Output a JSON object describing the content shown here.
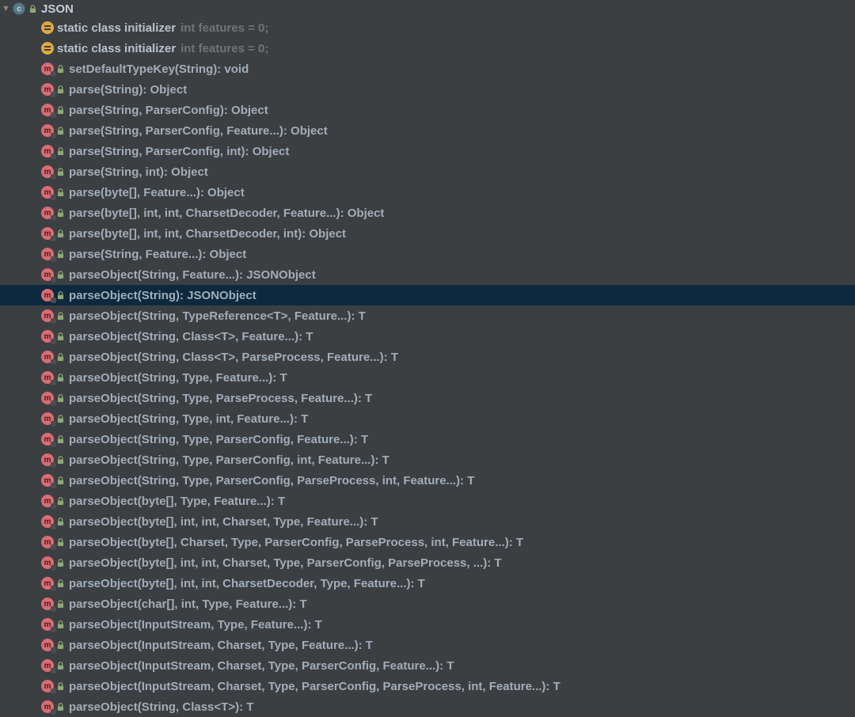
{
  "root": {
    "name": "JSON"
  },
  "items": [
    {
      "kind": "init",
      "label": "static class initializer",
      "hint": "int features = 0;",
      "selected": false
    },
    {
      "kind": "init",
      "label": "static class initializer",
      "hint": "int features = 0;",
      "selected": false
    },
    {
      "kind": "method",
      "label": "setDefaultTypeKey(String): void",
      "selected": false
    },
    {
      "kind": "method",
      "label": "parse(String): Object",
      "selected": false
    },
    {
      "kind": "method",
      "label": "parse(String, ParserConfig): Object",
      "selected": false
    },
    {
      "kind": "method",
      "label": "parse(String, ParserConfig, Feature...): Object",
      "selected": false
    },
    {
      "kind": "method",
      "label": "parse(String, ParserConfig, int): Object",
      "selected": false
    },
    {
      "kind": "method",
      "label": "parse(String, int): Object",
      "selected": false
    },
    {
      "kind": "method",
      "label": "parse(byte[], Feature...): Object",
      "selected": false
    },
    {
      "kind": "method",
      "label": "parse(byte[], int, int, CharsetDecoder, Feature...): Object",
      "selected": false
    },
    {
      "kind": "method",
      "label": "parse(byte[], int, int, CharsetDecoder, int): Object",
      "selected": false
    },
    {
      "kind": "method",
      "label": "parse(String, Feature...): Object",
      "selected": false
    },
    {
      "kind": "method",
      "label": "parseObject(String, Feature...): JSONObject",
      "selected": false
    },
    {
      "kind": "method",
      "label": "parseObject(String): JSONObject",
      "selected": true
    },
    {
      "kind": "method",
      "label": "parseObject(String, TypeReference<T>, Feature...): T",
      "selected": false
    },
    {
      "kind": "method",
      "label": "parseObject(String, Class<T>, Feature...): T",
      "selected": false
    },
    {
      "kind": "method",
      "label": "parseObject(String, Class<T>, ParseProcess, Feature...): T",
      "selected": false
    },
    {
      "kind": "method",
      "label": "parseObject(String, Type, Feature...): T",
      "selected": false
    },
    {
      "kind": "method",
      "label": "parseObject(String, Type, ParseProcess, Feature...): T",
      "selected": false
    },
    {
      "kind": "method",
      "label": "parseObject(String, Type, int, Feature...): T",
      "selected": false
    },
    {
      "kind": "method",
      "label": "parseObject(String, Type, ParserConfig, Feature...): T",
      "selected": false
    },
    {
      "kind": "method",
      "label": "parseObject(String, Type, ParserConfig, int, Feature...): T",
      "selected": false
    },
    {
      "kind": "method",
      "label": "parseObject(String, Type, ParserConfig, ParseProcess, int, Feature...): T",
      "selected": false
    },
    {
      "kind": "method",
      "label": "parseObject(byte[], Type, Feature...): T",
      "selected": false
    },
    {
      "kind": "method",
      "label": "parseObject(byte[], int, int, Charset, Type, Feature...): T",
      "selected": false
    },
    {
      "kind": "method",
      "label": "parseObject(byte[], Charset, Type, ParserConfig, ParseProcess, int, Feature...): T",
      "selected": false
    },
    {
      "kind": "method",
      "label": "parseObject(byte[], int, int, Charset, Type, ParserConfig, ParseProcess, ...): T",
      "selected": false
    },
    {
      "kind": "method",
      "label": "parseObject(byte[], int, int, CharsetDecoder, Type, Feature...): T",
      "selected": false
    },
    {
      "kind": "method",
      "label": "parseObject(char[], int, Type, Feature...): T",
      "selected": false
    },
    {
      "kind": "method",
      "label": "parseObject(InputStream, Type, Feature...): T",
      "selected": false
    },
    {
      "kind": "method",
      "label": "parseObject(InputStream, Charset, Type, Feature...): T",
      "selected": false
    },
    {
      "kind": "method",
      "label": "parseObject(InputStream, Charset, Type, ParserConfig, Feature...): T",
      "selected": false
    },
    {
      "kind": "method",
      "label": "parseObject(InputStream, Charset, Type, ParserConfig, ParseProcess, int, Feature...): T",
      "selected": false
    },
    {
      "kind": "method",
      "label": "parseObject(String, Class<T>): T",
      "selected": false
    }
  ]
}
